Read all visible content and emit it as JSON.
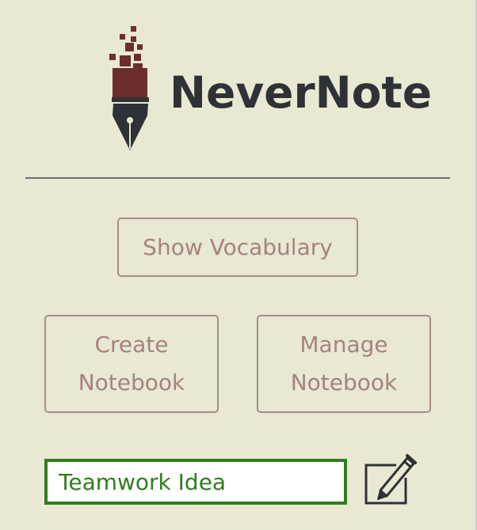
{
  "app": {
    "name": "NeverNote"
  },
  "buttons": {
    "show_vocabulary": "Show Vocabulary",
    "create_notebook": [
      "Create",
      "Notebook"
    ],
    "manage_notebook": [
      "Manage",
      "Notebook"
    ]
  },
  "note_input": {
    "value": "Teamwork Idea"
  },
  "icons": {
    "logo": "pen-nib-pixel-logo-icon",
    "edit": "edit-pencil-square-icon"
  },
  "colors": {
    "background": "#e9e8d3",
    "logo_text": "#2e3135",
    "logo_mark": "#6e2d2d",
    "button_border": "#a98c89",
    "button_text": "#a4837f",
    "input_border": "#2f7d1f",
    "divider": "#6b6e73"
  }
}
